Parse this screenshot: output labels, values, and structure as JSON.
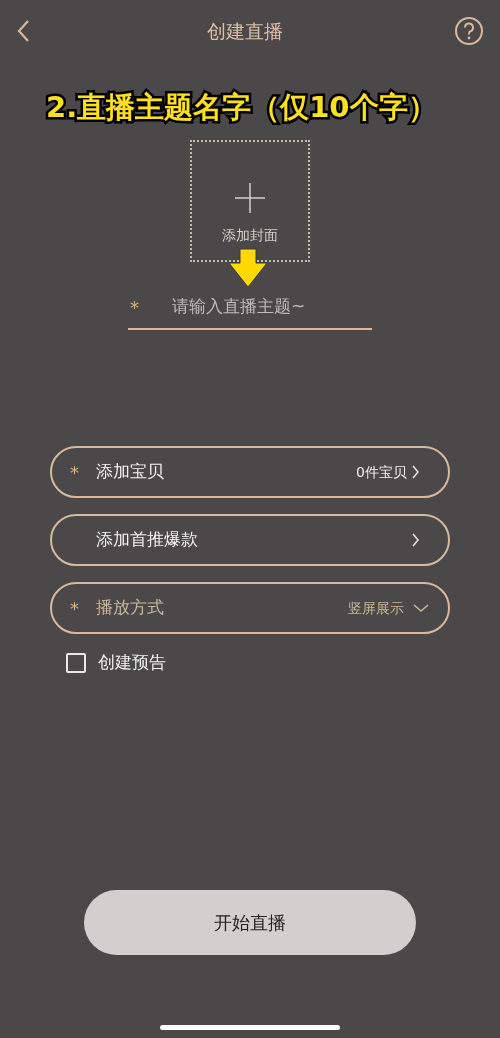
{
  "header": {
    "title": "创建直播"
  },
  "cover": {
    "label": "添加封面"
  },
  "topic": {
    "required_mark": "*",
    "placeholder": "请输入直播主题~"
  },
  "rows": [
    {
      "kind": "link",
      "required": true,
      "label": "添加宝贝",
      "value": "0件宝贝"
    },
    {
      "kind": "link",
      "required": false,
      "label": "添加首推爆款"
    },
    {
      "kind": "dropdown",
      "required": true,
      "label": "播放方式",
      "value": "竖屏展示"
    }
  ],
  "preview": {
    "label": "创建预告",
    "checked": false
  },
  "start_button": "开始直播",
  "annotation": {
    "text": "2.直播主题名字（仅10个字）"
  }
}
